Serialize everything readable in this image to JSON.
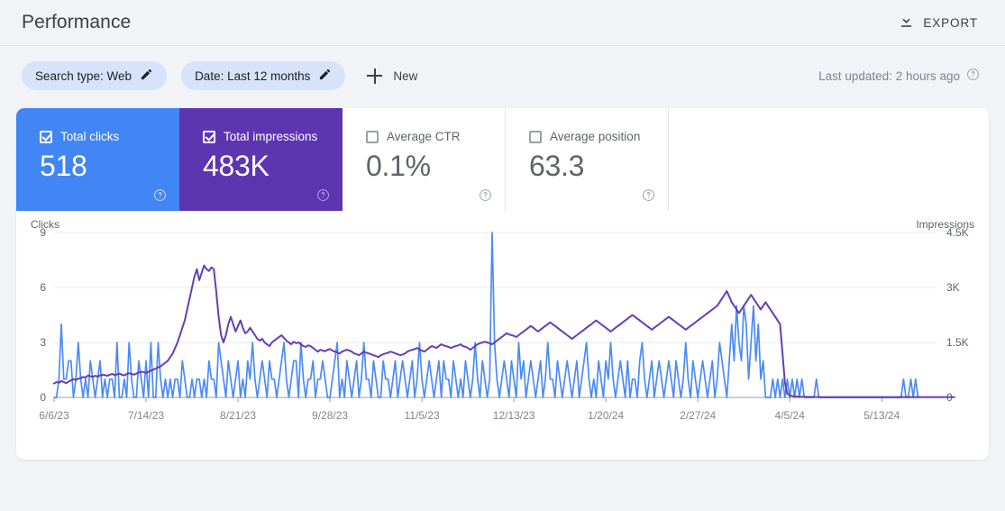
{
  "header": {
    "title": "Performance",
    "export_label": "EXPORT",
    "export_icon": "download-icon"
  },
  "filters": {
    "chips": [
      {
        "label": "Search type: Web",
        "icon": "pencil-icon"
      },
      {
        "label": "Date: Last 12 months",
        "icon": "pencil-icon"
      }
    ],
    "new_label": "New",
    "new_icon": "plus-icon",
    "last_updated": "Last updated: 2 hours ago",
    "help_icon": "help-circle-icon"
  },
  "metrics": [
    {
      "label": "Total clicks",
      "value": "518",
      "checked": true,
      "color": "#4285F4",
      "help_icon": "help-circle-icon"
    },
    {
      "label": "Total impressions",
      "value": "483K",
      "checked": true,
      "color": "#5E35B1",
      "help_icon": "help-circle-icon"
    },
    {
      "label": "Average CTR",
      "value": "0.1%",
      "checked": false,
      "color": "#FFFFFF",
      "help_icon": "help-circle-icon"
    },
    {
      "label": "Average position",
      "value": "63.3",
      "checked": false,
      "color": "#FFFFFF",
      "help_icon": "help-circle-icon"
    }
  ],
  "chart_data": {
    "type": "line",
    "title": "",
    "xlabel": "",
    "ylabel": "Clicks",
    "y2label": "Impressions",
    "grid": true,
    "legend": "none",
    "ylim": [
      0,
      9
    ],
    "y2lim": [
      0,
      4500
    ],
    "yticks": [
      "0",
      "3",
      "6",
      "9"
    ],
    "y2ticks": [
      "0",
      "1.5K",
      "3K",
      "4.5K"
    ],
    "xticks": [
      "6/6/23",
      "7/14/23",
      "8/21/23",
      "9/28/23",
      "11/5/23",
      "12/13/23",
      "1/20/24",
      "2/27/24",
      "4/5/24",
      "5/13/24"
    ],
    "xtick_index": [
      0,
      38,
      76,
      114,
      152,
      190,
      228,
      266,
      304,
      342
    ],
    "n_points": 366,
    "series": [
      {
        "name": "Total clicks",
        "color": "#4285F4",
        "axis": "left",
        "values": [
          0,
          0,
          1,
          4,
          1,
          1,
          2,
          2,
          0,
          1,
          3,
          1,
          0,
          1,
          0,
          2,
          1,
          0,
          1,
          2,
          0,
          1,
          0,
          1,
          1,
          0,
          3,
          0,
          0,
          1,
          0,
          3,
          1,
          0,
          0,
          2,
          1,
          0,
          2,
          0,
          3,
          0,
          0,
          3,
          1,
          0,
          1,
          0,
          1,
          0,
          1,
          1,
          0,
          2,
          1,
          0,
          0,
          1,
          0,
          1,
          1,
          0,
          1,
          0,
          2,
          1,
          1,
          0,
          3,
          2,
          1,
          0,
          2,
          1,
          0,
          1,
          2,
          0,
          1,
          0,
          2,
          1,
          3,
          1,
          0,
          1,
          2,
          1,
          0,
          2,
          1,
          1,
          0,
          1,
          2,
          3,
          1,
          0,
          1,
          2,
          2,
          0,
          3,
          1,
          0,
          1,
          1,
          2,
          0,
          1,
          1,
          2,
          1,
          0,
          0,
          1,
          2,
          3,
          0,
          1,
          0,
          2,
          1,
          0,
          1,
          2,
          0,
          1,
          3,
          1,
          1,
          0,
          2,
          1,
          0,
          0,
          2,
          1,
          1,
          0,
          1,
          2,
          0,
          1,
          2,
          1,
          0,
          1,
          2,
          0,
          1,
          3,
          1,
          0,
          1,
          2,
          1,
          0,
          1,
          2,
          0,
          2,
          1,
          1,
          0,
          2,
          1,
          0,
          1,
          0,
          2,
          1,
          0,
          1,
          3,
          1,
          0,
          2,
          1,
          0,
          1,
          9,
          3,
          1,
          0,
          1,
          2,
          1,
          0,
          2,
          1,
          0,
          3,
          1,
          2,
          0,
          1,
          2,
          1,
          0,
          1,
          2,
          0,
          1,
          3,
          1,
          1,
          0,
          2,
          1,
          0,
          1,
          2,
          1,
          0,
          1,
          2,
          0,
          1,
          2,
          3,
          1,
          0,
          1,
          0,
          2,
          1,
          0,
          2,
          1,
          3,
          1,
          0,
          1,
          2,
          1,
          0,
          2,
          0,
          1,
          1,
          0,
          2,
          3,
          1,
          0,
          1,
          2,
          0,
          1,
          2,
          1,
          0,
          1,
          2,
          1,
          0,
          2,
          1,
          0,
          1,
          3,
          1,
          0,
          2,
          1,
          0,
          1,
          2,
          1,
          0,
          1,
          2,
          0,
          1,
          3,
          2,
          1,
          0,
          2,
          4,
          2,
          5,
          3,
          2,
          5,
          4,
          1,
          3,
          5,
          2,
          4,
          1,
          2,
          0,
          0,
          0,
          1,
          0,
          1,
          0,
          1,
          0,
          1,
          0,
          1,
          0,
          1,
          0,
          1,
          0,
          0,
          0,
          0,
          0,
          1,
          0,
          0,
          0,
          0,
          0,
          0,
          0,
          0,
          0,
          0,
          0,
          0,
          0,
          0,
          0,
          0,
          0,
          0,
          0,
          0,
          0,
          0,
          0,
          0,
          0,
          0,
          0,
          0,
          0,
          0,
          0,
          0,
          0,
          0,
          0,
          1,
          0,
          0,
          1,
          0,
          1,
          0
        ]
      },
      {
        "name": "Total impressions",
        "color": "#5E35B1",
        "axis": "right",
        "values": [
          380,
          420,
          400,
          450,
          420,
          390,
          430,
          470,
          500,
          480,
          510,
          530,
          560,
          540,
          600,
          580,
          560,
          590,
          570,
          600,
          620,
          610,
          590,
          620,
          640,
          610,
          630,
          650,
          620,
          600,
          640,
          660,
          640,
          620,
          650,
          680,
          700,
          690,
          670,
          700,
          730,
          760,
          790,
          820,
          850,
          900,
          950,
          1000,
          1100,
          1200,
          1350,
          1500,
          1700,
          1900,
          2100,
          2400,
          2700,
          3000,
          3300,
          3500,
          3200,
          3400,
          3600,
          3500,
          3450,
          3550,
          3500,
          2900,
          2200,
          1700,
          1500,
          1700,
          2000,
          2200,
          2000,
          1800,
          1950,
          2100,
          1900,
          1750,
          1800,
          1900,
          1800,
          1700,
          1600,
          1550,
          1600,
          1500,
          1450,
          1400,
          1500,
          1550,
          1600,
          1650,
          1700,
          1620,
          1550,
          1500,
          1450,
          1520,
          1480,
          1500,
          1450,
          1400,
          1380,
          1420,
          1400,
          1350,
          1300,
          1250,
          1300,
          1280,
          1260,
          1300,
          1320,
          1280,
          1250,
          1230,
          1200,
          1250,
          1280,
          1300,
          1280,
          1250,
          1200,
          1180,
          1150,
          1200,
          1250,
          1220,
          1200,
          1180,
          1150,
          1130,
          1100,
          1150,
          1180,
          1200,
          1220,
          1250,
          1230,
          1200,
          1180,
          1150,
          1170,
          1200,
          1250,
          1280,
          1300,
          1320,
          1350,
          1300,
          1280,
          1250,
          1300,
          1350,
          1400,
          1380,
          1350,
          1400,
          1450,
          1420,
          1400,
          1380,
          1350,
          1380,
          1400,
          1420,
          1450,
          1400,
          1380,
          1350,
          1300,
          1350,
          1400,
          1450,
          1480,
          1500,
          1520,
          1500,
          1480,
          1450,
          1500,
          1550,
          1600,
          1650,
          1700,
          1750,
          1720,
          1700,
          1680,
          1650,
          1700,
          1750,
          1800,
          1850,
          1900,
          1950,
          1900,
          1850,
          1800,
          1850,
          1900,
          1950,
          2000,
          2050,
          2000,
          1950,
          1900,
          1850,
          1800,
          1750,
          1700,
          1650,
          1600,
          1650,
          1700,
          1750,
          1800,
          1850,
          1900,
          1950,
          2000,
          2050,
          2100,
          2050,
          2000,
          1950,
          1900,
          1850,
          1800,
          1850,
          1900,
          1950,
          2000,
          2050,
          2100,
          2150,
          2200,
          2250,
          2200,
          2150,
          2100,
          2050,
          2000,
          1950,
          1900,
          1850,
          1900,
          1950,
          2000,
          2050,
          2100,
          2150,
          2200,
          2150,
          2100,
          2050,
          2000,
          1950,
          1900,
          1850,
          1900,
          1950,
          2000,
          2050,
          2100,
          2150,
          2200,
          2250,
          2300,
          2350,
          2400,
          2450,
          2500,
          2600,
          2700,
          2800,
          2900,
          2750,
          2600,
          2500,
          2400,
          2300,
          2400,
          2500,
          2600,
          2700,
          2800,
          2700,
          2600,
          2500,
          2400,
          2500,
          2600,
          2500,
          2400,
          2300,
          2200,
          2100,
          2000,
          1200,
          400,
          100,
          60,
          40,
          30,
          25,
          20,
          18,
          16,
          15,
          14,
          13,
          12,
          11,
          10,
          10,
          10,
          10,
          10,
          10,
          10,
          10,
          10,
          10,
          10,
          10,
          10,
          10,
          10,
          10,
          10,
          10,
          10,
          10,
          10,
          10,
          10,
          10,
          10,
          10,
          10,
          10,
          10,
          10,
          10,
          10,
          10,
          10,
          10,
          10,
          10,
          10,
          10,
          10,
          10,
          10,
          10,
          10,
          10,
          10,
          10,
          10,
          10,
          10,
          10,
          10,
          10,
          10,
          10,
          10,
          10
        ]
      }
    ]
  }
}
